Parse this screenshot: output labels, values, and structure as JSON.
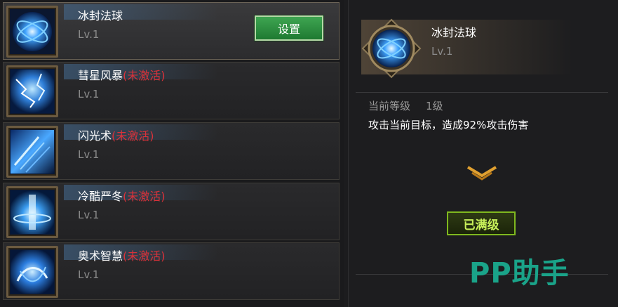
{
  "skills": [
    {
      "name": "冰封法球",
      "status": "",
      "level": "Lv.1",
      "icon": "ice-orb-icon"
    },
    {
      "name": "彗星风暴",
      "status": "(未激活)",
      "level": "Lv.1",
      "icon": "comet-storm-icon"
    },
    {
      "name": "闪光术",
      "status": "(未激活)",
      "level": "Lv.1",
      "icon": "flash-spell-icon"
    },
    {
      "name": "冷酷严冬",
      "status": "(未激活)",
      "level": "Lv.1",
      "icon": "harsh-winter-icon"
    },
    {
      "name": "奥术智慧",
      "status": "(未激活)",
      "level": "Lv.1",
      "icon": "arcane-wisdom-icon"
    }
  ],
  "set_button_label": "设置",
  "detail": {
    "name": "冰封法球",
    "level": "Lv.1",
    "current_level_label": "当前等级",
    "current_level_value": "1级",
    "description": "攻击当前目标，造成92%攻击伤害",
    "maxed_label": "已满级"
  },
  "watermark": "PP助手",
  "colors": {
    "inactive_status": "#d9323a",
    "button_green": "#2f9142",
    "maxed_border": "#7fb81e",
    "watermark": "#1aa389"
  }
}
